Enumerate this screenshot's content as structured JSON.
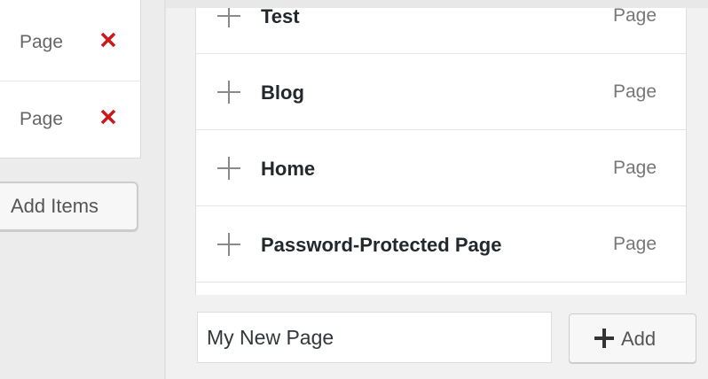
{
  "menu_items": [
    {
      "type": "Page",
      "remove_icon": "close-icon",
      "remove_color": "#cc1818"
    },
    {
      "type": "Page",
      "remove_icon": "close-icon",
      "remove_color": "#cc1818"
    }
  ],
  "add_items_button": {
    "label": "Add Items"
  },
  "page_list": [
    {
      "title": "Test",
      "type": "Page",
      "icon": "plus-icon"
    },
    {
      "title": "Blog",
      "type": "Page",
      "icon": "plus-icon"
    },
    {
      "title": "Home",
      "type": "Page",
      "icon": "plus-icon"
    },
    {
      "title": "Password-Protected Page",
      "type": "Page",
      "icon": "plus-icon"
    },
    {
      "title": "",
      "type": "",
      "icon": "plus-icon"
    }
  ],
  "new_page": {
    "value": "My New Page",
    "add_label": "Add",
    "add_icon": "plus-icon"
  }
}
